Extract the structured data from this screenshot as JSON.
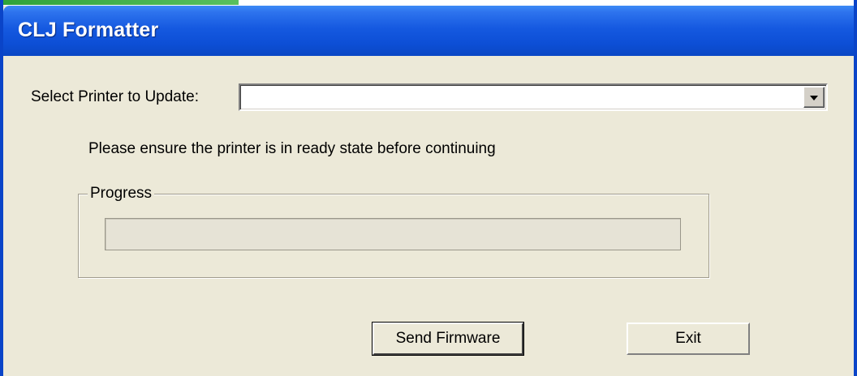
{
  "window": {
    "title": "CLJ Formatter"
  },
  "form": {
    "printer_label": "Select Printer to Update:",
    "printer_value": "",
    "instruction": "Please ensure the printer is in ready state before continuing"
  },
  "progress": {
    "group_label": "Progress",
    "value_percent": 0
  },
  "buttons": {
    "send_label": "Send Firmware",
    "exit_label": "Exit"
  },
  "colors": {
    "titlebar": "#0d4fd6",
    "dialog_background": "#ece9d8",
    "progress_fill": "#2f6fd6"
  }
}
